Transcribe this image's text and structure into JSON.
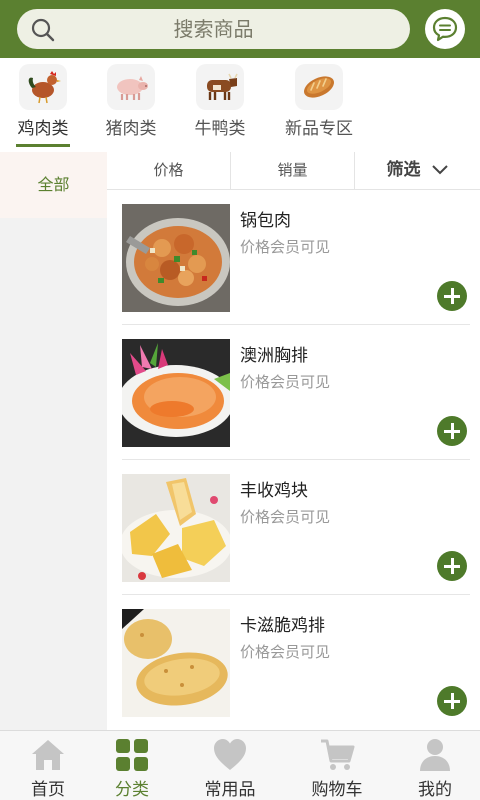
{
  "header": {
    "search_placeholder": "搜索商品",
    "search_icon": "search-icon",
    "message_icon": "chat-bubble-icon",
    "brand_color": "#5b8030"
  },
  "categories": [
    {
      "label": "鸡肉类",
      "icon": "rooster-icon",
      "active": true
    },
    {
      "label": "猪肉类",
      "icon": "pig-icon",
      "active": false
    },
    {
      "label": "牛鸭类",
      "icon": "cow-icon",
      "active": false
    },
    {
      "label": "新品专区",
      "icon": "bread-icon",
      "active": false
    }
  ],
  "sidebar": {
    "items": [
      {
        "label": "全部",
        "active": true
      }
    ]
  },
  "sortbar": {
    "price": "价格",
    "sales": "销量",
    "filter": "筛选",
    "filter_icon": "chevron-down-icon"
  },
  "products": [
    {
      "name": "锅包肉",
      "price_text": "价格会员可见",
      "image": "fried-pork-dish"
    },
    {
      "name": "澳洲胸排",
      "price_text": "价格会员可见",
      "image": "chicken-breast-cutlet"
    },
    {
      "name": "丰收鸡块",
      "price_text": "价格会员可见",
      "image": "chicken-nuggets"
    },
    {
      "name": "卡滋脆鸡排",
      "price_text": "价格会员可见",
      "image": "crispy-chicken-fillet"
    }
  ],
  "tabbar": {
    "items": [
      {
        "label": "首页",
        "icon": "home-icon",
        "active": false
      },
      {
        "label": "分类",
        "icon": "grid-icon",
        "active": true
      },
      {
        "label": "常用品",
        "icon": "heart-icon",
        "active": false
      },
      {
        "label": "购物车",
        "icon": "cart-icon",
        "active": false
      },
      {
        "label": "我的",
        "icon": "user-icon",
        "active": false
      }
    ]
  }
}
